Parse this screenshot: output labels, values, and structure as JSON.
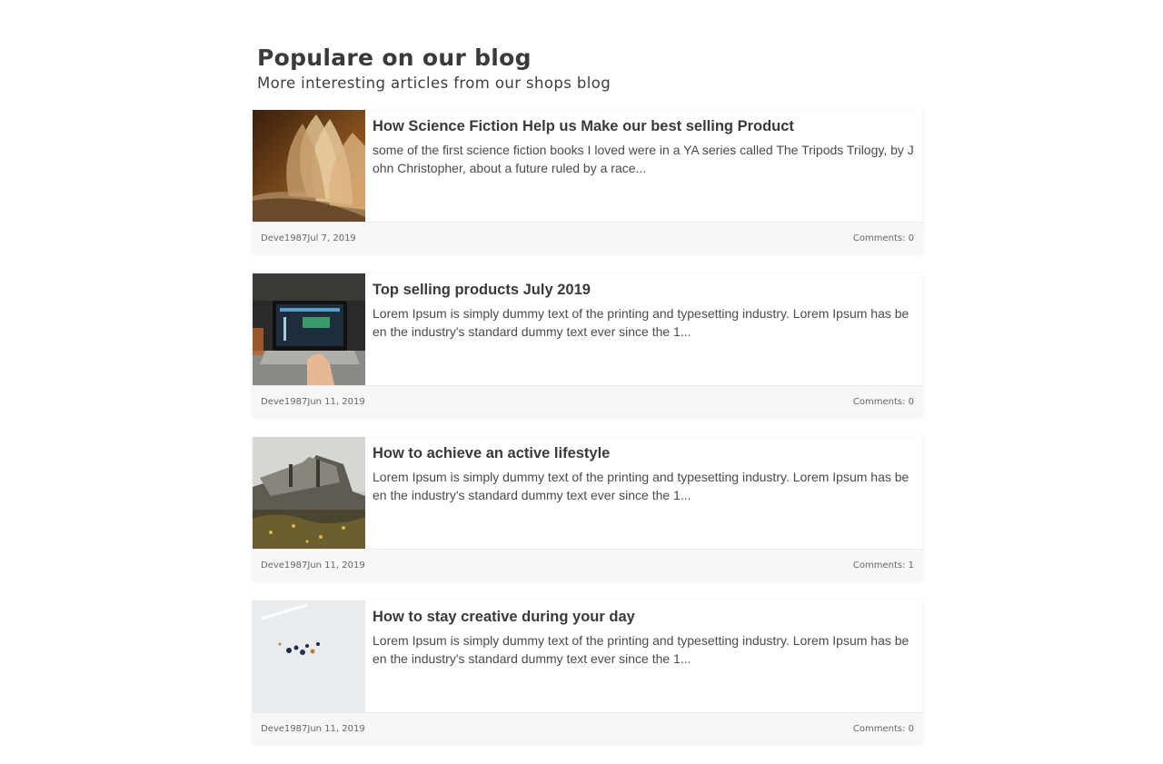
{
  "header": {
    "title": "Populare on our blog",
    "subtitle": "More interesting articles from our shops blog"
  },
  "posts": [
    {
      "title": "How Science Fiction Help us Make our best selling Product",
      "excerpt": "some of the first science fiction books I loved were in a YA series called The Tripods Trilogy, by John Christopher, about a future ruled by a race...",
      "author": "Deve1987",
      "date": "Jul 7, 2019",
      "comments": "Comments: 0",
      "image": "book-pages"
    },
    {
      "title": "Top selling products July 2019",
      "excerpt": "Lorem Ipsum is simply dummy text of the printing and typesetting industry. Lorem Ipsum has been the industry's standard dummy text ever since the 1...",
      "author": "Deve1987",
      "date": "Jun 11, 2019",
      "comments": "Comments: 0",
      "image": "laptop-desk"
    },
    {
      "title": "How to achieve an active lifestyle",
      "excerpt": "Lorem Ipsum is simply dummy text of the printing and typesetting industry. Lorem Ipsum has been the industry's standard dummy text ever since the 1...",
      "author": "Deve1987",
      "date": "Jun 11, 2019",
      "comments": "Comments: 1",
      "image": "shipwreck-field"
    },
    {
      "title": "How to stay creative during your day",
      "excerpt": "Lorem Ipsum is simply dummy text of the printing and typesetting industry. Lorem Ipsum has been the industry's standard dummy text ever since the 1...",
      "author": "Deve1987",
      "date": "Jun 11, 2019",
      "comments": "Comments: 0",
      "image": "creative-desk"
    }
  ]
}
